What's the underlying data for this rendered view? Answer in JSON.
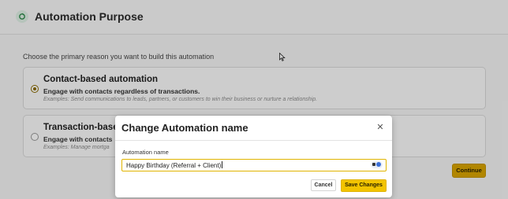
{
  "header": {
    "title": "Automation Purpose"
  },
  "prompt": "Choose the primary reason you want to build this automation",
  "options": [
    {
      "title": "Contact-based automation",
      "subtitle": "Engage with contacts regardless of transactions.",
      "example": "Examples: Send communications to leads, partners, or customers to win their business or nurture a relationship.",
      "selected": true
    },
    {
      "title": "Transaction-based",
      "subtitle": "Engage with contacts",
      "example": "Examples: Manage mortga",
      "selected": false
    }
  ],
  "continue_label": "Continue",
  "modal": {
    "title": "Change Automation name",
    "field_label": "Automation name",
    "field_value": "Happy Birthday (Referral + Client)",
    "cancel_label": "Cancel",
    "save_label": "Save Changes"
  },
  "colors": {
    "accent": "#f2c400",
    "accent_dark": "#d8a400",
    "overlay": "rgba(0,0,0,0.18)"
  }
}
